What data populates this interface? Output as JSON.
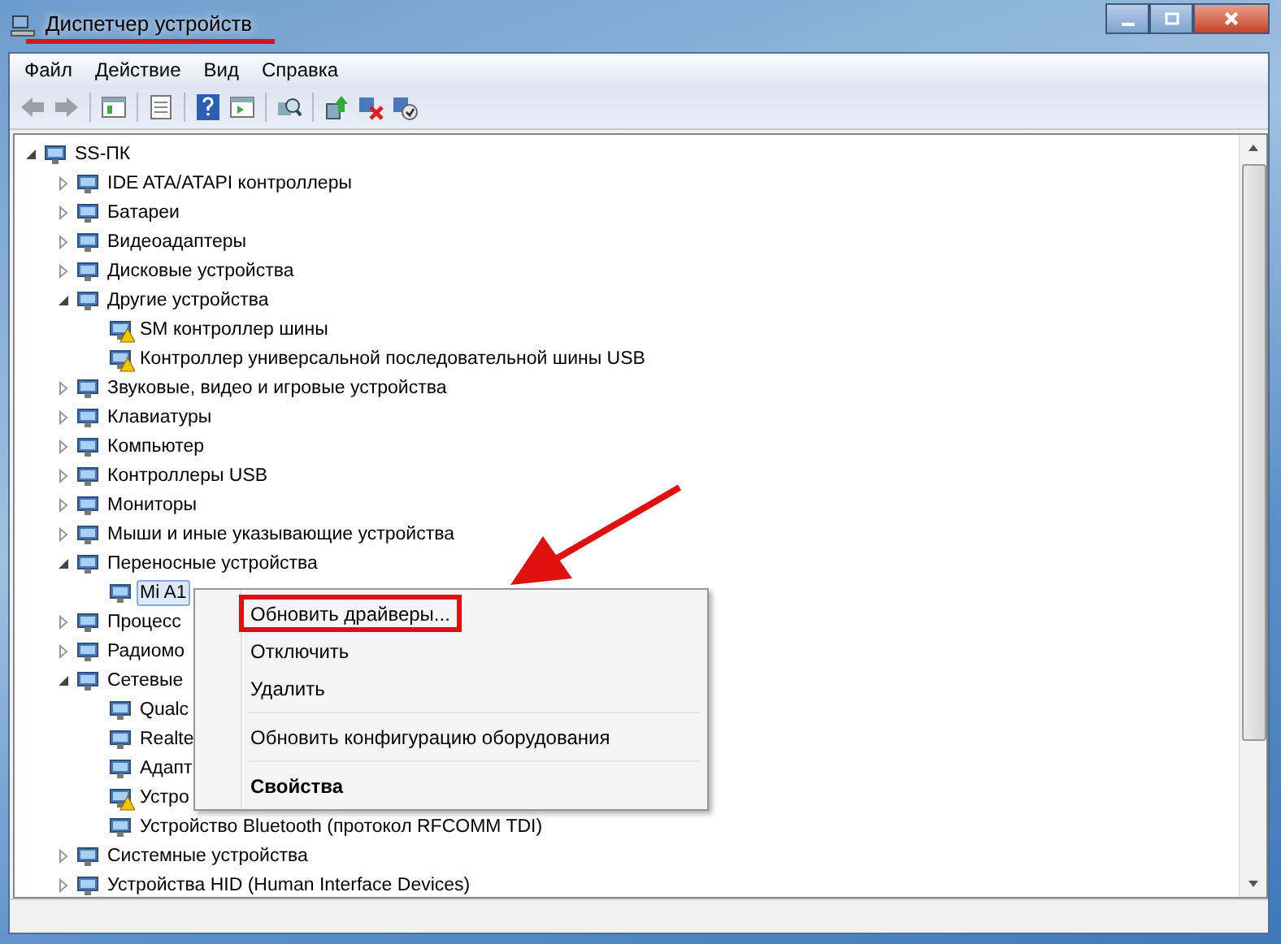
{
  "window": {
    "title": "Диспетчер устройств",
    "title_underlined": true
  },
  "menu_bar": [
    "Файл",
    "Действие",
    "Вид",
    "Справка"
  ],
  "tree": {
    "label": "SS-ПК",
    "expanded": true,
    "selected": false,
    "warning": false,
    "children": [
      {
        "label": "IDE ATA/ATAPI контроллеры",
        "expanded": false,
        "selected": false,
        "warning": false
      },
      {
        "label": "Батареи",
        "expanded": false,
        "selected": false,
        "warning": false
      },
      {
        "label": "Видеоадаптеры",
        "expanded": false,
        "selected": false,
        "warning": false
      },
      {
        "label": "Дисковые устройства",
        "expanded": false,
        "selected": false,
        "warning": false
      },
      {
        "label": "Другие устройства",
        "expanded": true,
        "selected": false,
        "warning": false,
        "children": [
          {
            "label": "SM контроллер шины",
            "selected": false,
            "warning": true
          },
          {
            "label": "Контроллер универсальной последовательной шины USB",
            "selected": false,
            "warning": true
          }
        ]
      },
      {
        "label": "Звуковые, видео и игровые устройства",
        "expanded": false,
        "selected": false,
        "warning": false
      },
      {
        "label": "Клавиатуры",
        "expanded": false,
        "selected": false,
        "warning": false
      },
      {
        "label": "Компьютер",
        "expanded": false,
        "selected": false,
        "warning": false
      },
      {
        "label": "Контроллеры USB",
        "expanded": false,
        "selected": false,
        "warning": false
      },
      {
        "label": "Мониторы",
        "expanded": false,
        "selected": false,
        "warning": false
      },
      {
        "label": "Мыши и иные указывающие устройства",
        "expanded": false,
        "selected": false,
        "warning": false
      },
      {
        "label": "Переносные устройства",
        "expanded": true,
        "selected": false,
        "warning": false,
        "children": [
          {
            "label": "Mi A1",
            "selected": true,
            "warning": false
          }
        ]
      },
      {
        "label": "Процесс",
        "expanded": false,
        "selected": false,
        "warning": false
      },
      {
        "label": "Радиомо",
        "expanded": false,
        "selected": false,
        "warning": false
      },
      {
        "label": "Сетевые",
        "expanded": true,
        "selected": false,
        "warning": false,
        "children": [
          {
            "label": "Qualc",
            "selected": false,
            "warning": false
          },
          {
            "label": "Realte",
            "selected": false,
            "warning": false
          },
          {
            "label": "Адапт",
            "selected": false,
            "warning": false
          },
          {
            "label": "Устро",
            "selected": false,
            "warning": true
          },
          {
            "label": "Устройство Bluetooth (протокол RFCOMM TDI)",
            "selected": false,
            "warning": false
          }
        ]
      },
      {
        "label": "Системные устройства",
        "expanded": false,
        "selected": false,
        "warning": false
      },
      {
        "label": "Устройства HID (Human Interface Devices)",
        "expanded": false,
        "selected": false,
        "warning": false
      }
    ]
  },
  "context_menu": {
    "items": [
      {
        "kind": "item",
        "label": "Обновить драйверы...",
        "default": false,
        "annotated": true
      },
      {
        "kind": "item",
        "label": "Отключить",
        "default": false,
        "annotated": false
      },
      {
        "kind": "item",
        "label": "Удалить",
        "default": false,
        "annotated": false
      },
      {
        "kind": "separator"
      },
      {
        "kind": "item",
        "label": "Обновить конфигурацию оборудования",
        "default": false,
        "annotated": false
      },
      {
        "kind": "separator"
      },
      {
        "kind": "item",
        "label": "Свойства",
        "default": true,
        "annotated": false
      }
    ]
  },
  "annotation_arrow": true
}
